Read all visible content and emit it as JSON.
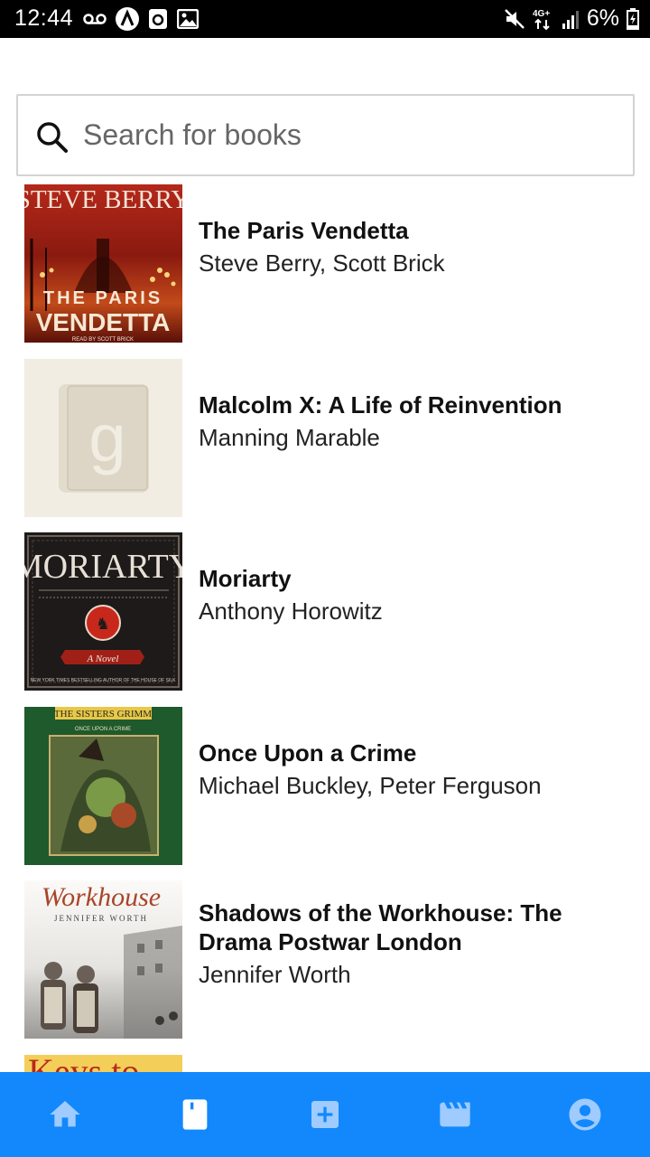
{
  "status_bar": {
    "time": "12:44",
    "battery": "6%",
    "network": "4G+",
    "left_icons": [
      "voicemail-icon",
      "a-circle-icon",
      "camera-square-icon",
      "image-icon"
    ],
    "right_icons": [
      "mute-icon",
      "network-4g-icon",
      "signal-icon",
      "battery-icon"
    ]
  },
  "search": {
    "placeholder": "Search for books",
    "value": ""
  },
  "books": [
    {
      "title": "The Paris Vendetta",
      "author": "Steve Berry, Scott Brick",
      "cover": {
        "top": "STEVE BERRY",
        "bottom_line1": "THE PARIS",
        "bottom_line2": "VENDETTA",
        "credit": "READ BY SCOTT BRICK"
      }
    },
    {
      "title": "Malcolm X: A Life of Reinvention",
      "author": "Manning Marable",
      "cover": {
        "placeholder_letter": "g"
      }
    },
    {
      "title": "Moriarty",
      "author": "Anthony Horowitz",
      "cover": {
        "top": "MORIARTY",
        "badge": "A Novel",
        "credit": "NEW YORK TIMES BESTSELLING AUTHOR OF THE HOUSE OF SILK"
      }
    },
    {
      "title": "Once Upon a Crime",
      "author": "Michael Buckley, Peter Ferguson",
      "cover": {
        "top": "THE SISTERS GRIMM",
        "sub": "ONCE UPON A CRIME"
      }
    },
    {
      "title": "Shadows of the Workhouse: The Drama Postwar London",
      "author": "Jennifer Worth",
      "cover": {
        "top": "Workhouse",
        "sub": "JENNIFER WORTH"
      }
    },
    {
      "title": "",
      "author": "",
      "cover": {
        "top": "Keys to"
      }
    }
  ],
  "bottom_nav": {
    "items": [
      "home-icon",
      "book-icon",
      "add-icon",
      "movies-icon",
      "account-icon"
    ],
    "active": "book-icon",
    "icon_color": "#9fcbff",
    "active_color": "#ffffff",
    "background": "#1288fc"
  }
}
